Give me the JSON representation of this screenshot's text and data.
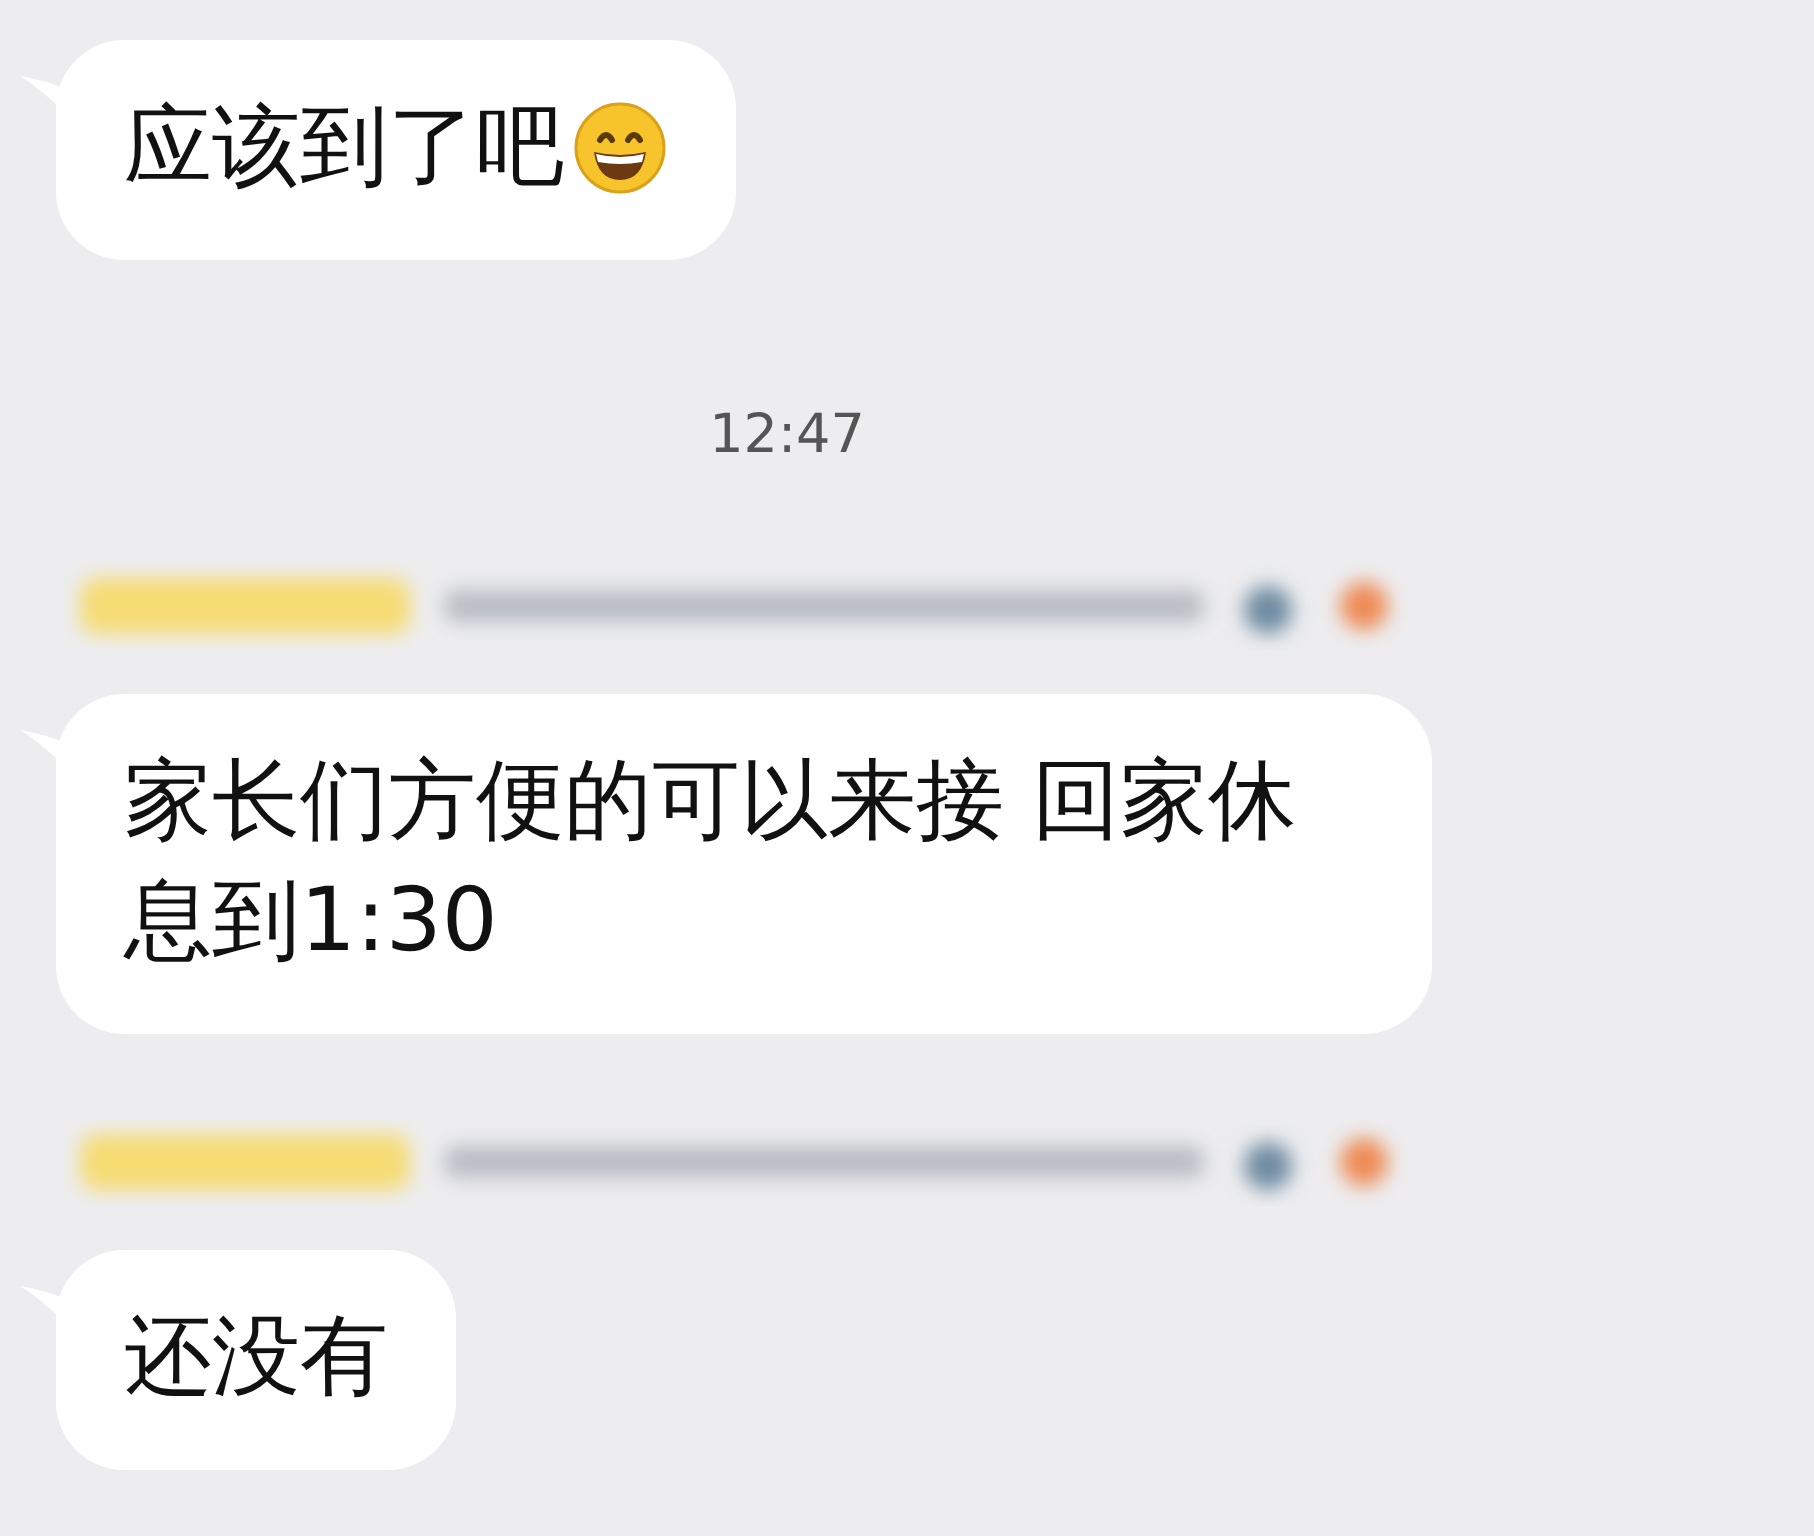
{
  "messages": [
    {
      "kind": "message",
      "text": "应该到了吧",
      "has_emoji": true
    },
    {
      "kind": "time",
      "text": "12:47"
    },
    {
      "kind": "sender"
    },
    {
      "kind": "message",
      "text": "家长们方便的可以来接 回家休息到1:30",
      "has_emoji": false
    },
    {
      "kind": "sender"
    },
    {
      "kind": "message",
      "text": "还没有",
      "has_emoji": false
    }
  ]
}
